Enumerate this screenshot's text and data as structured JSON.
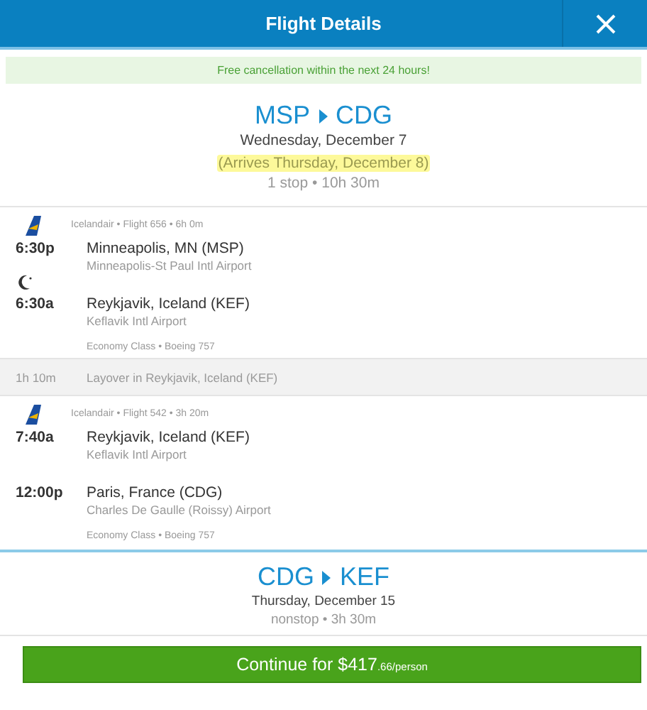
{
  "header": {
    "title": "Flight Details"
  },
  "notice": "Free cancellation within the next 24 hours!",
  "trips": [
    {
      "origin": "MSP",
      "destination": "CDG",
      "date": "Wednesday, December 7",
      "arrival_note": "(Arrives Thursday, December 8)",
      "summary": "1 stop • 10h 30m",
      "expanded": true,
      "segments": [
        {
          "kind": "flight",
          "info": "Icelandair • Flight 656 • 6h 0m",
          "overnight": true,
          "stops": [
            {
              "time": "6:30p",
              "city": "Minneapolis, MN (MSP)",
              "airport": "Minneapolis-St Paul Intl Airport"
            },
            {
              "time": "6:30a",
              "city": "Reykjavik, Iceland (KEF)",
              "airport": "Keflavik Intl Airport"
            }
          ],
          "details": "Economy Class • Boeing 757"
        },
        {
          "kind": "layover",
          "duration": "1h 10m",
          "text": "Layover in Reykjavik, Iceland (KEF)"
        },
        {
          "kind": "flight",
          "info": "Icelandair • Flight 542 • 3h 20m",
          "overnight": false,
          "stops": [
            {
              "time": "7:40a",
              "city": "Reykjavik, Iceland (KEF)",
              "airport": "Keflavik Intl Airport"
            },
            {
              "time": "12:00p",
              "city": "Paris, France (CDG)",
              "airport": "Charles De Gaulle (Roissy) Airport"
            }
          ],
          "details": "Economy Class • Boeing 757"
        }
      ]
    },
    {
      "origin": "CDG",
      "destination": "KEF",
      "date": "Thursday, December 15",
      "summary": "nonstop • 3h 30m",
      "expanded": false
    }
  ],
  "continue_button": {
    "label": "Continue for $417",
    "suffix": ".66/person"
  }
}
